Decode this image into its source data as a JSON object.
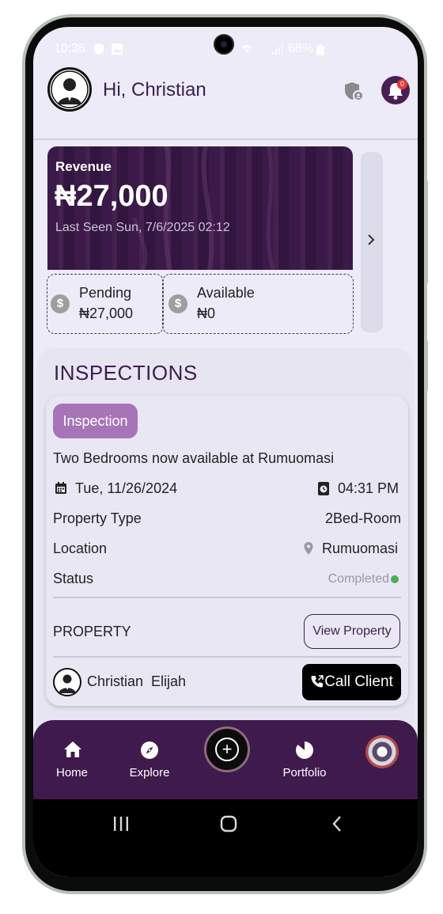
{
  "status_bar": {
    "time": "10:36",
    "battery": "68%"
  },
  "header": {
    "greeting": "Hi, Christian",
    "notification_count": "0"
  },
  "revenue": {
    "label": "Revenue",
    "amount": "₦27,000",
    "last_seen": "Last Seen Sun, 7/6/2025 02:12",
    "pending_label": "Pending",
    "pending_value": "₦27,000",
    "available_label": "Available",
    "available_value": "₦0",
    "coin_symbol": "$"
  },
  "inspections": {
    "section_title": "INSPECTIONS",
    "tag": "Inspection",
    "title": "Two Bedrooms now available at Rumuomasi",
    "date": "Tue, 11/26/2024",
    "time": "04:31 PM",
    "property_type_label": "Property Type",
    "property_type_value": "2Bed-Room",
    "location_label": "Location",
    "location_value": "Rumuomasi",
    "status_label": "Status",
    "status_value": "Completed",
    "property_label": "PROPERTY",
    "view_property_label": "View Property",
    "client_name": "Christian  Elijah",
    "call_client_label": "Call Client"
  },
  "bottom_nav": {
    "items": [
      {
        "label": "Home",
        "icon": "home-icon"
      },
      {
        "label": "Explore",
        "icon": "compass-icon"
      },
      {
        "label": "Portfolio",
        "icon": "pie-chart-icon"
      }
    ]
  },
  "colors": {
    "brand_purple": "#3f1a4d",
    "tag_purple": "#a774b8",
    "status_green": "#4caf50",
    "badge_red": "#e53935"
  }
}
